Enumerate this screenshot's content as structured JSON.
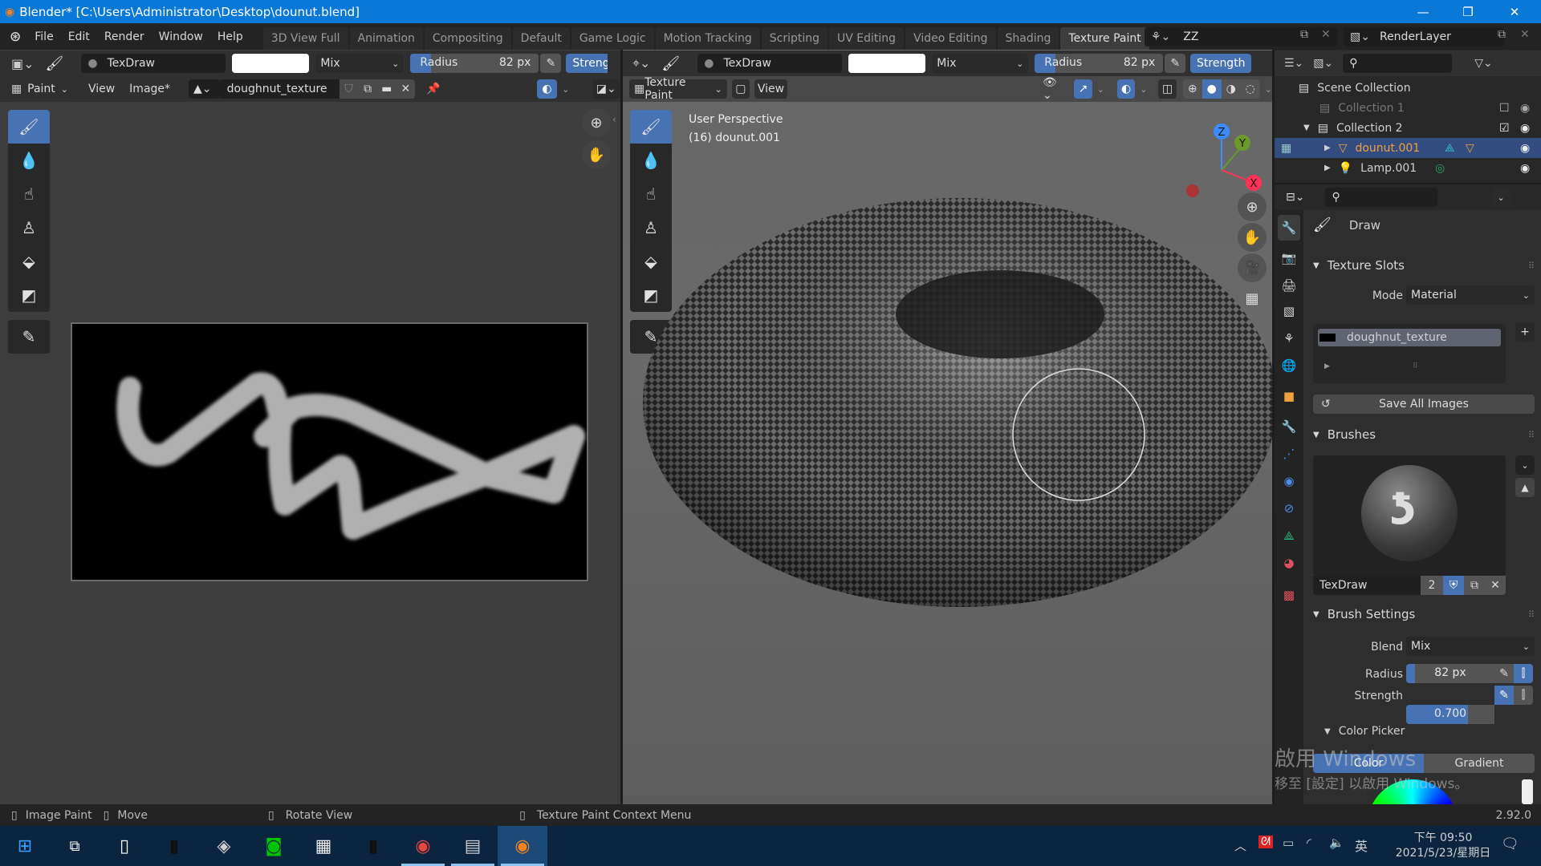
{
  "window": {
    "title": "Blender* [C:\\Users\\Administrator\\Desktop\\dounut.blend]",
    "minimize_label": "—",
    "restore_label": "❐",
    "close_label": "✕"
  },
  "menu": {
    "items": [
      "File",
      "Edit",
      "Render",
      "Window",
      "Help"
    ]
  },
  "workspaces": {
    "tabs": [
      "3D View Full",
      "Animation",
      "Compositing",
      "Default",
      "Game Logic",
      "Motion Tracking",
      "Scripting",
      "UV Editing",
      "Video Editing",
      "Shading",
      "Texture Paint"
    ],
    "active": "Texture Paint",
    "add_label": "+"
  },
  "scene": {
    "name": "ZZ"
  },
  "view_layer": {
    "name": "RenderLayer"
  },
  "image_editor": {
    "header": {
      "brush_name": "TexDraw",
      "blend": "Mix",
      "radius_label": "Radius",
      "radius_value": "82 px",
      "radius_fraction": 0.16,
      "strength_label": "Strength"
    },
    "subheader": {
      "mode": "Paint",
      "view_menu": "View",
      "image_menu": "Image*",
      "image_name": "doughnut_texture"
    },
    "tools": [
      "draw",
      "soften",
      "smear",
      "clone",
      "fill",
      "mask",
      "annotate"
    ]
  },
  "viewport": {
    "header": {
      "brush_name": "TexDraw",
      "blend": "Mix",
      "radius_label": "Radius",
      "radius_value": "82 px",
      "radius_fraction": 0.16,
      "strength_label": "Strength"
    },
    "subheader": {
      "mode": "Texture Paint",
      "view_menu": "View"
    },
    "overlay_text": {
      "perspective": "User Perspective",
      "object": "(16)  dounut.001"
    },
    "gizmo": {
      "x": "X",
      "y": "Y",
      "z": "Z"
    },
    "tools": [
      "draw",
      "soften",
      "smear",
      "clone",
      "fill",
      "mask",
      "annotate"
    ]
  },
  "outliner": {
    "root": "Scene Collection",
    "items": [
      {
        "name": "Collection 1",
        "type": "collection",
        "checked": false,
        "dim": true
      },
      {
        "name": "Collection 2",
        "type": "collection",
        "checked": true,
        "dim": false
      },
      {
        "name": "dounut.001",
        "type": "mesh",
        "selected": true
      },
      {
        "name": "Lamp.001",
        "type": "light",
        "selected": false
      }
    ]
  },
  "properties": {
    "tool_name": "Draw",
    "texture_slots": {
      "title": "Texture Slots",
      "mode_label": "Mode",
      "mode_value": "Material",
      "slots": [
        "doughnut_texture"
      ],
      "save_all_label": "Save All Images"
    },
    "brushes": {
      "title": "Brushes",
      "brush_name": "TexDraw",
      "users": "2"
    },
    "brush_settings": {
      "title": "Brush Settings",
      "blend_label": "Blend",
      "blend_value": "Mix",
      "radius_label": "Radius",
      "radius_value": "82 px",
      "radius_fraction": 0.1,
      "strength_label": "Strength",
      "strength_value": "0.700",
      "strength_fraction": 0.7
    },
    "color_picker": {
      "title": "Color Picker",
      "tabs": [
        "Color",
        "Gradient"
      ],
      "active": "Color"
    }
  },
  "watermark": {
    "line1": "啟用 Windows",
    "line2": "移至 [設定] 以啟用 Windows。"
  },
  "statusbar": {
    "items": [
      "Image Paint",
      "Move",
      "Rotate View",
      "Texture Paint Context Menu"
    ],
    "version": "2.92.0"
  },
  "taskbar": {
    "apps": [
      "start",
      "task-view",
      "notepad",
      "app-dark",
      "app-box",
      "line",
      "calendar",
      "calculator",
      "chrome",
      "monitor",
      "blender"
    ],
    "tray": {
      "ime": "英",
      "time": "下午 09:50",
      "date": "2021/5/23/星期日"
    }
  },
  "colors": {
    "accent": "#4772b3",
    "title_bar": "#0a78d7",
    "taskbar": "#0b2540",
    "selected_object": "#f0a040"
  }
}
